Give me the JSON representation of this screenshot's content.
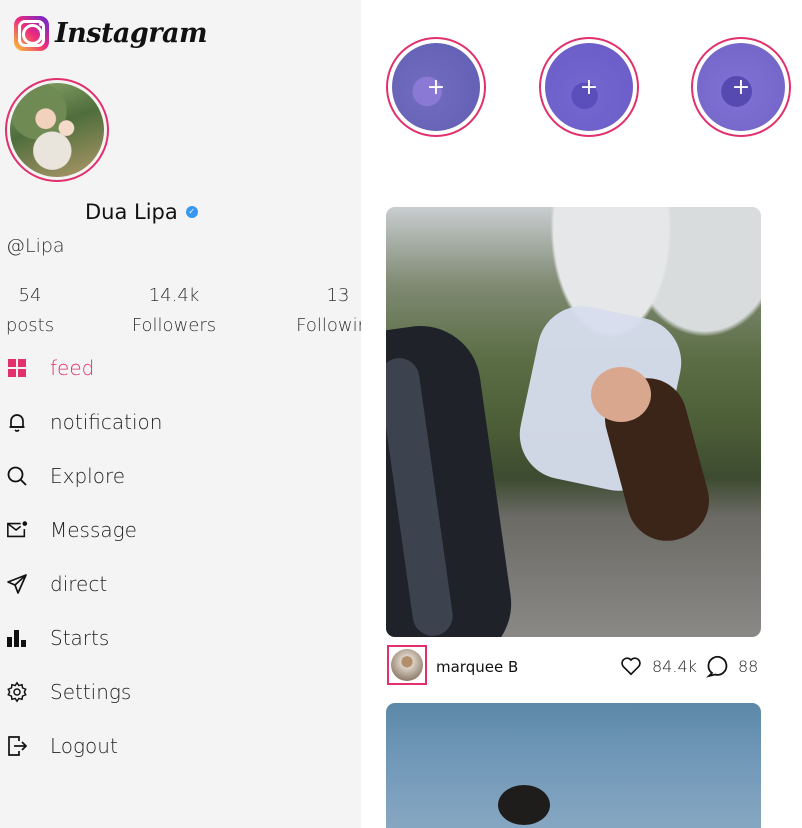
{
  "app": {
    "logo_text": "Instagram"
  },
  "profile": {
    "name": "Dua Lipa",
    "verified_icon": "✓",
    "handle": "@Lipa",
    "stats": [
      {
        "value": "54",
        "label": "posts"
      },
      {
        "value": "14.4k",
        "label": "Followers"
      },
      {
        "value": "13",
        "label": "Following"
      }
    ]
  },
  "nav": [
    {
      "label": "feed",
      "icon": "grid-icon",
      "active": true
    },
    {
      "label": "notification",
      "icon": "bell-icon"
    },
    {
      "label": "Explore",
      "icon": "search-icon"
    },
    {
      "label": "Message",
      "icon": "mail-icon"
    },
    {
      "label": "direct",
      "icon": "send-icon"
    },
    {
      "label": "Starts",
      "icon": "bar-chart-icon"
    },
    {
      "label": "Settings",
      "icon": "gear-icon"
    },
    {
      "label": "Logout",
      "icon": "logout-icon"
    }
  ],
  "stories": [
    {
      "plus": "+"
    },
    {
      "plus": "+"
    },
    {
      "plus": "+"
    }
  ],
  "post": {
    "username": "marquee B",
    "likes": "84.4k",
    "comments": "88"
  },
  "colors": {
    "accent": "#e1306c",
    "story_overlay": "#6256dc",
    "sidebar_bg": "#f4f4f4"
  }
}
